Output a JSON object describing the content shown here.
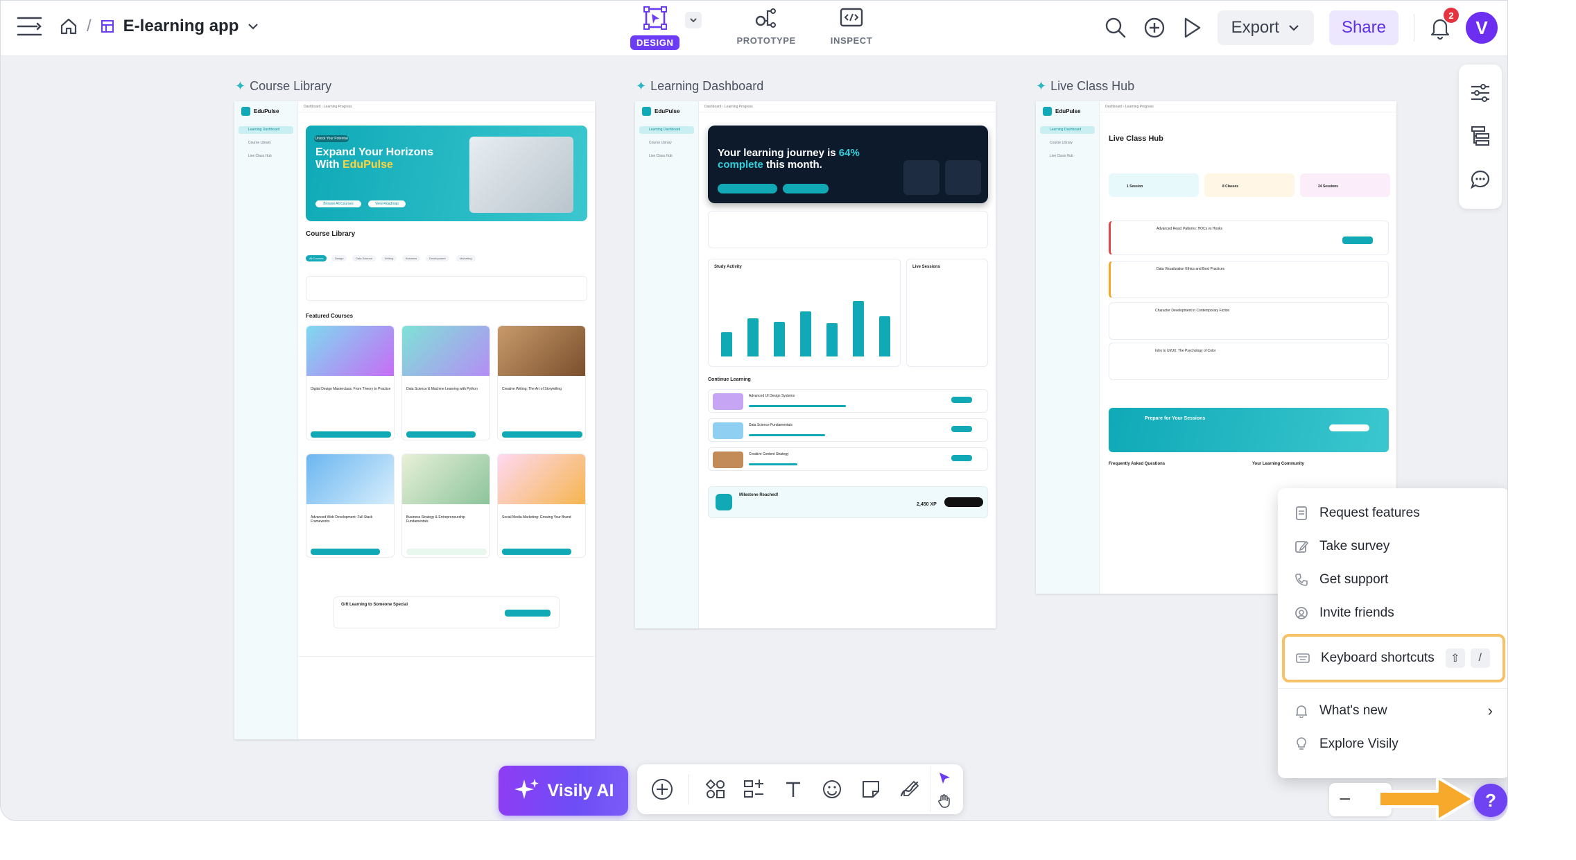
{
  "topbar": {
    "project_name": "E-learning app",
    "modes": [
      {
        "label": "DESIGN",
        "active": true
      },
      {
        "label": "PROTOTYPE",
        "active": false
      },
      {
        "label": "INSPECT",
        "active": false
      }
    ],
    "export_label": "Export",
    "share_label": "Share",
    "notification_count": "2",
    "avatar_initial": "V"
  },
  "screens": {
    "course_library": {
      "title": "Course Library",
      "brand": "EduPulse",
      "hero_line1": "Expand Your Horizons",
      "hero_line2a": "With ",
      "hero_line2b": "EduPulse",
      "heading": "Course Library",
      "featured": "Featured Courses",
      "gift_title": "Gift Learning to Someone Special",
      "chips": [
        "All Courses",
        "Design",
        "Data Science",
        "Writing",
        "Business",
        "Development",
        "Marketing"
      ],
      "courses": [
        "Digital Design Masterclass: From Theory to Practice",
        "Data Science & Machine Learning with Python",
        "Creative Writing: The Art of Storytelling",
        "Advanced Web Development: Full Stack Frameworks",
        "Business Strategy & Entrepreneurship Fundamentals",
        "Social Media Marketing: Growing Your Brand"
      ]
    },
    "learning_dashboard": {
      "title": "Learning Dashboard",
      "brand": "EduPulse",
      "hero_a": "Your learning journey is ",
      "hero_pct": "64%",
      "hero_b": "complete",
      "hero_c": " this month.",
      "study_activity": "Study Activity",
      "live_sessions": "Live Sessions",
      "continue": "Continue Learning",
      "lessons": [
        "Advanced UI Design Systems",
        "Data Science Fundamentals",
        "Creative Content Strategy"
      ],
      "milestone": "Milestone Reached!",
      "xp": "2,450 XP",
      "bars": [
        35,
        55,
        50,
        65,
        48,
        80,
        58
      ]
    },
    "live_class_hub": {
      "title": "Live Class Hub",
      "brand": "EduPulse",
      "heading": "Live Class Hub",
      "stats": [
        "1 Session",
        "8 Classes",
        "24 Sessions"
      ],
      "sessions": [
        "Advanced React Patterns: HOCs vs Hooks",
        "Data Visualization Ethics and Best Practices",
        "Character Development in Contemporary Fiction",
        "Intro to UI/UX: The Psychology of Color"
      ],
      "prepare": "Prepare for Your Sessions",
      "faq": "Frequently Asked Questions",
      "community": "Your Learning Community"
    }
  },
  "help_menu": {
    "items": [
      "Request features",
      "Take survey",
      "Get support",
      "Invite friends"
    ],
    "shortcuts_label": "Keyboard shortcuts",
    "shortcut_keys": [
      "⇧",
      "/"
    ],
    "whats_new": "What's new",
    "explore": "Explore Visily"
  },
  "bottom": {
    "ai_label": "Visily AI",
    "zoom_minus": "−",
    "help": "?"
  },
  "colors": {
    "accent": "#6c3cf5",
    "teal": "#12a9b7",
    "highlight": "#f7c267",
    "arrow": "#f6a92a"
  }
}
